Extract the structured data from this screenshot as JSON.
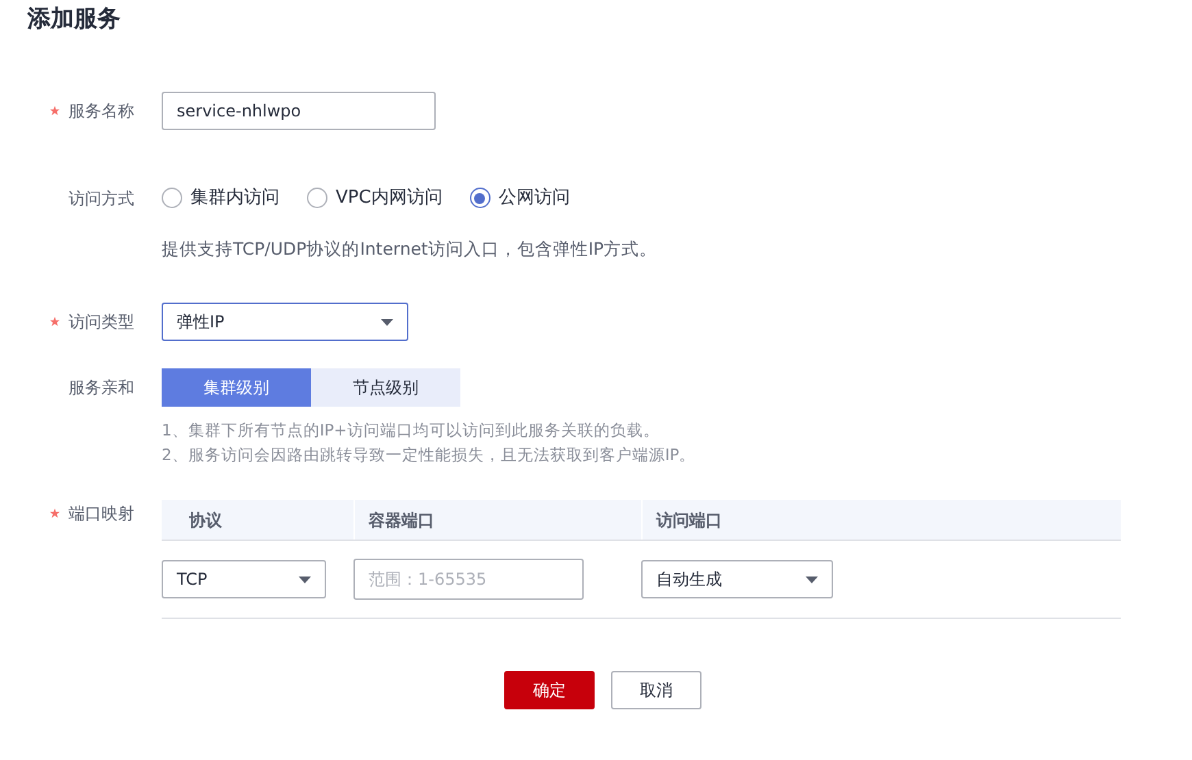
{
  "title": "添加服务",
  "service_name": {
    "label": "服务名称",
    "required": true,
    "value": "service-nhlwpo"
  },
  "access_method": {
    "label": "访问方式",
    "required": false,
    "options": [
      {
        "label": "集群内访问",
        "selected": false
      },
      {
        "label": "VPC内网访问",
        "selected": false
      },
      {
        "label": "公网访问",
        "selected": true
      }
    ],
    "description": "提供支持TCP/UDP协议的Internet访问入口，包含弹性IP方式。"
  },
  "access_type": {
    "label": "访问类型",
    "required": true,
    "value": "弹性IP"
  },
  "affinity": {
    "label": "服务亲和",
    "required": false,
    "options": [
      {
        "label": "集群级别",
        "selected": true
      },
      {
        "label": "节点级别",
        "selected": false
      }
    ],
    "notes": [
      "1、集群下所有节点的IP+访问端口均可以访问到此服务关联的负载。",
      "2、服务访问会因路由跳转导致一定性能损失，且无法获取到客户端源IP。"
    ]
  },
  "port_mapping": {
    "label": "端口映射",
    "required": true,
    "columns": [
      "协议",
      "容器端口",
      "访问端口"
    ],
    "rows": [
      {
        "protocol": "TCP",
        "container_port_placeholder": "范围：1-65535",
        "access_port": "自动生成"
      }
    ]
  },
  "buttons": [
    {
      "label": "确定",
      "kind": "primary"
    },
    {
      "label": "取消",
      "kind": "default"
    }
  ]
}
